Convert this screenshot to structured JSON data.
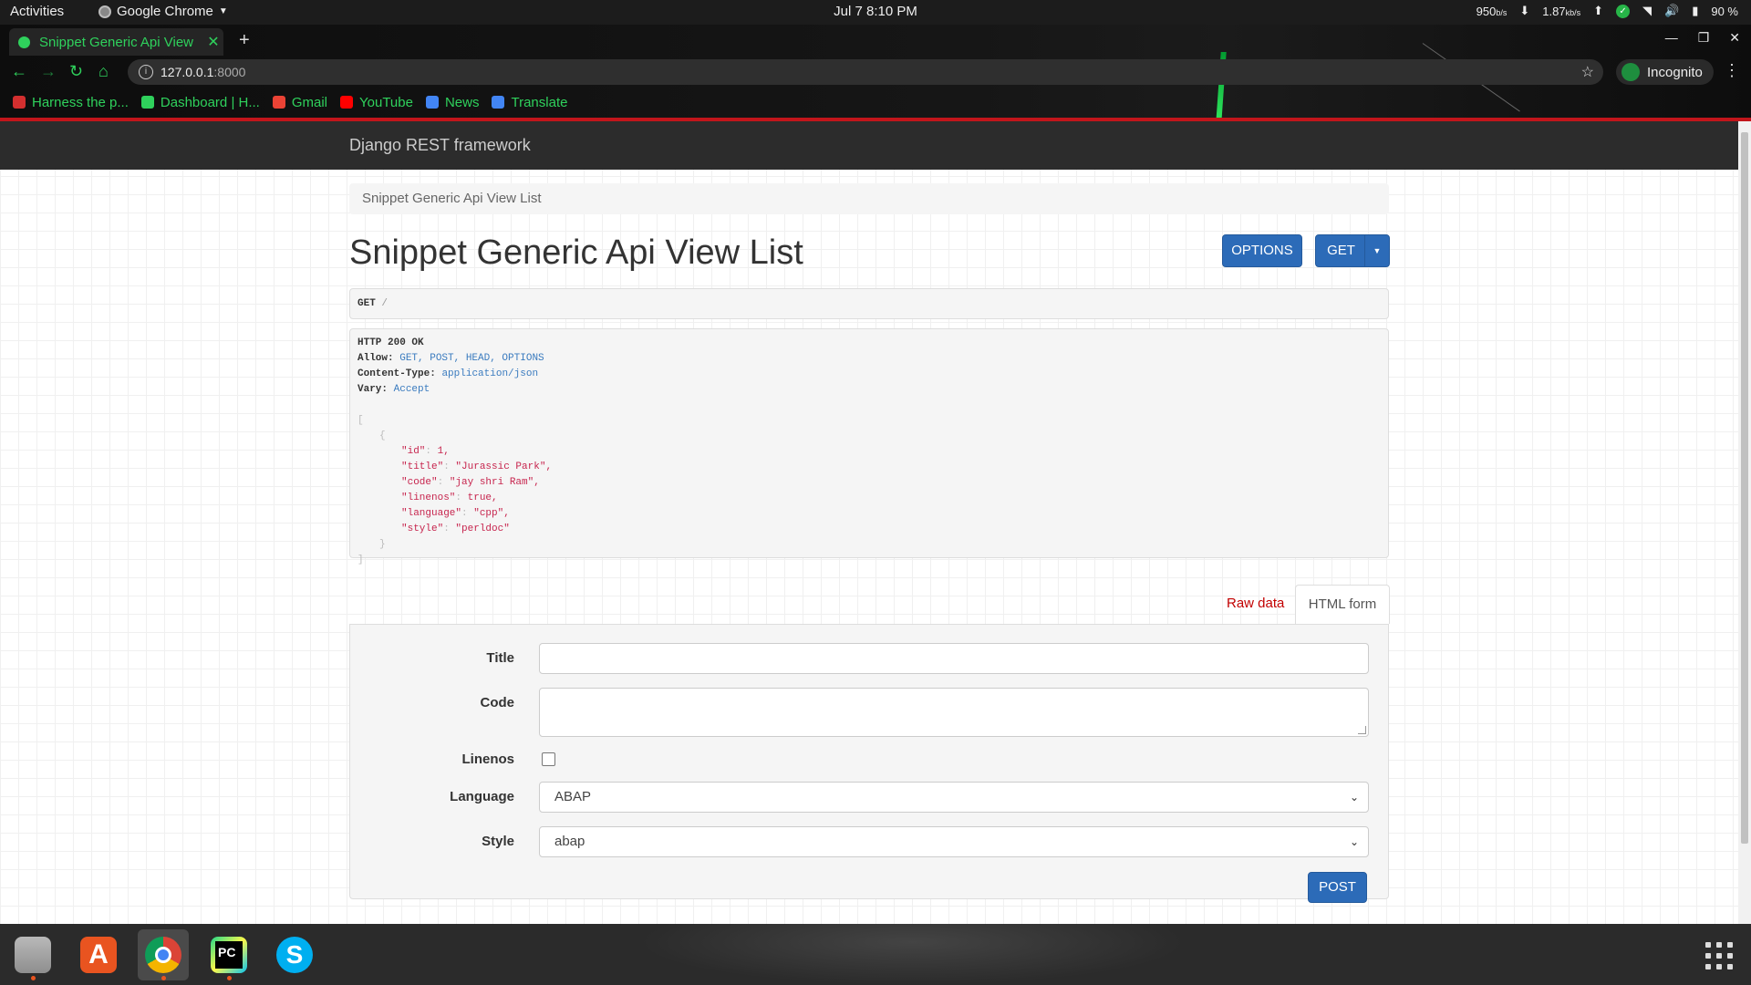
{
  "topbar": {
    "activities": "Activities",
    "app_name": "Google Chrome",
    "clock": "Jul 7  8:10 PM",
    "net_down_value": "950",
    "net_down_unit": "b/s",
    "net_up_value": "1.87",
    "net_up_unit": "kb/s",
    "battery": "90 %"
  },
  "browser": {
    "tab_title": "Snippet Generic Api View",
    "url_host": "127.0.0.1",
    "url_port": ":8000",
    "profile_label": "Incognito",
    "bookmarks": [
      {
        "label": "Harness the p...",
        "color": "#d32f2f"
      },
      {
        "label": "Dashboard | H...",
        "color": "#2fd15c"
      },
      {
        "label": "Gmail",
        "color": "#ea4335"
      },
      {
        "label": "YouTube",
        "color": "#ff0000"
      },
      {
        "label": "News",
        "color": "#4285f4"
      },
      {
        "label": "Translate",
        "color": "#4285f4"
      }
    ]
  },
  "page": {
    "brand": "Django REST framework",
    "breadcrumb": "Snippet Generic Api View List",
    "title": "Snippet Generic Api View List",
    "options_button": "OPTIONS",
    "get_button": "GET",
    "request": {
      "method": "GET",
      "path": "/"
    },
    "response": {
      "status": "HTTP 200 OK",
      "headers": [
        {
          "key": "Allow:",
          "value": "GET, POST, HEAD, OPTIONS"
        },
        {
          "key": "Content-Type:",
          "value": "application/json"
        },
        {
          "key": "Vary:",
          "value": "Accept"
        }
      ],
      "open_bracket": "[",
      "open_brace": "{",
      "fields": [
        {
          "key": "\"id\"",
          "value": "1,"
        },
        {
          "key": "\"title\"",
          "value": "\"Jurassic Park\","
        },
        {
          "key": "\"code\"",
          "value": "\"jay shri Ram\","
        },
        {
          "key": "\"linenos\"",
          "value": "true,"
        },
        {
          "key": "\"language\"",
          "value": "\"cpp\","
        },
        {
          "key": "\"style\"",
          "value": "\"perldoc\""
        }
      ],
      "close_brace": "}",
      "close_bracket": "]"
    },
    "form_tabs": {
      "raw": "Raw data",
      "html": "HTML form"
    },
    "form": {
      "title_label": "Title",
      "code_label": "Code",
      "linenos_label": "Linenos",
      "linenos_checked": false,
      "language_label": "Language",
      "language_value": "ABAP",
      "style_label": "Style",
      "style_value": "abap",
      "post_button": "POST"
    }
  },
  "colors": {
    "primary_button": "#2c6bb8",
    "chrome_accent_green": "#2fd15c",
    "chrome_red_bar": "#c2151b",
    "raw_data_link": "#c20000"
  },
  "dock": {
    "apps": [
      "files-icon",
      "software-store-icon",
      "chrome-icon",
      "pycharm-icon",
      "skype-icon",
      "show-apps-icon"
    ]
  }
}
